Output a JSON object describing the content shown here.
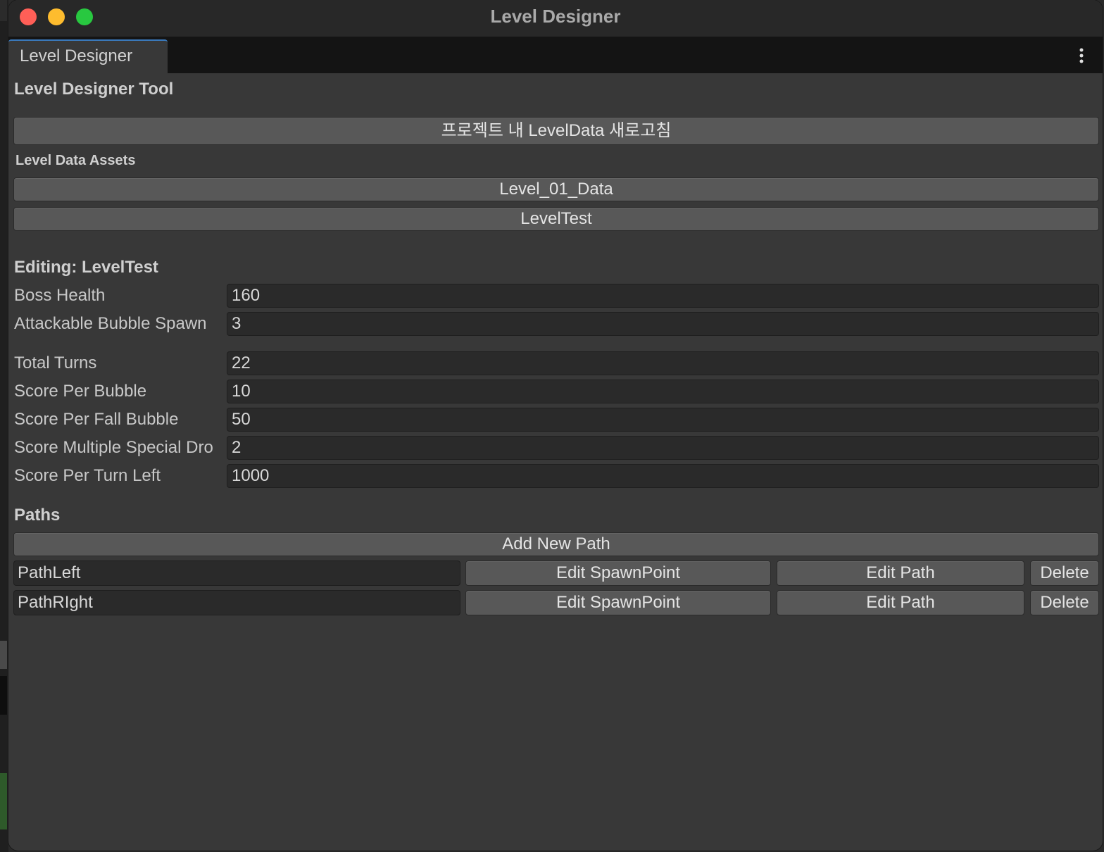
{
  "window": {
    "title": "Level Designer"
  },
  "tab": {
    "label": "Level Designer"
  },
  "tool": {
    "title": "Level Designer Tool",
    "refresh_button": "프로젝트 내 LevelData 새로고침"
  },
  "assets": {
    "label": "Level Data Assets",
    "items": [
      "Level_01_Data",
      "LevelTest"
    ]
  },
  "editing": {
    "title": "Editing: LevelTest",
    "fields": [
      {
        "label": "Boss Health",
        "value": "160"
      },
      {
        "label": "Attackable Bubble Spawn",
        "value": "3"
      },
      {
        "label": "Total Turns",
        "value": "22"
      },
      {
        "label": "Score Per Bubble",
        "value": "10"
      },
      {
        "label": "Score Per Fall Bubble",
        "value": "50"
      },
      {
        "label": "Score Multiple Special Dro",
        "value": "2"
      },
      {
        "label": "Score Per Turn Left",
        "value": "1000"
      }
    ]
  },
  "paths": {
    "title": "Paths",
    "add_button": "Add New Path",
    "edit_spawn_label": "Edit SpawnPoint",
    "edit_path_label": "Edit Path",
    "delete_label": "Delete",
    "items": [
      {
        "name": "PathLeft"
      },
      {
        "name": "PathRIght"
      }
    ]
  },
  "colors": {
    "close": "#ff5f57",
    "minimize": "#febc2e",
    "maximize": "#28c840",
    "tab_accent": "#3a79bb"
  },
  "icons": {
    "menu": "kebab-menu-icon"
  }
}
